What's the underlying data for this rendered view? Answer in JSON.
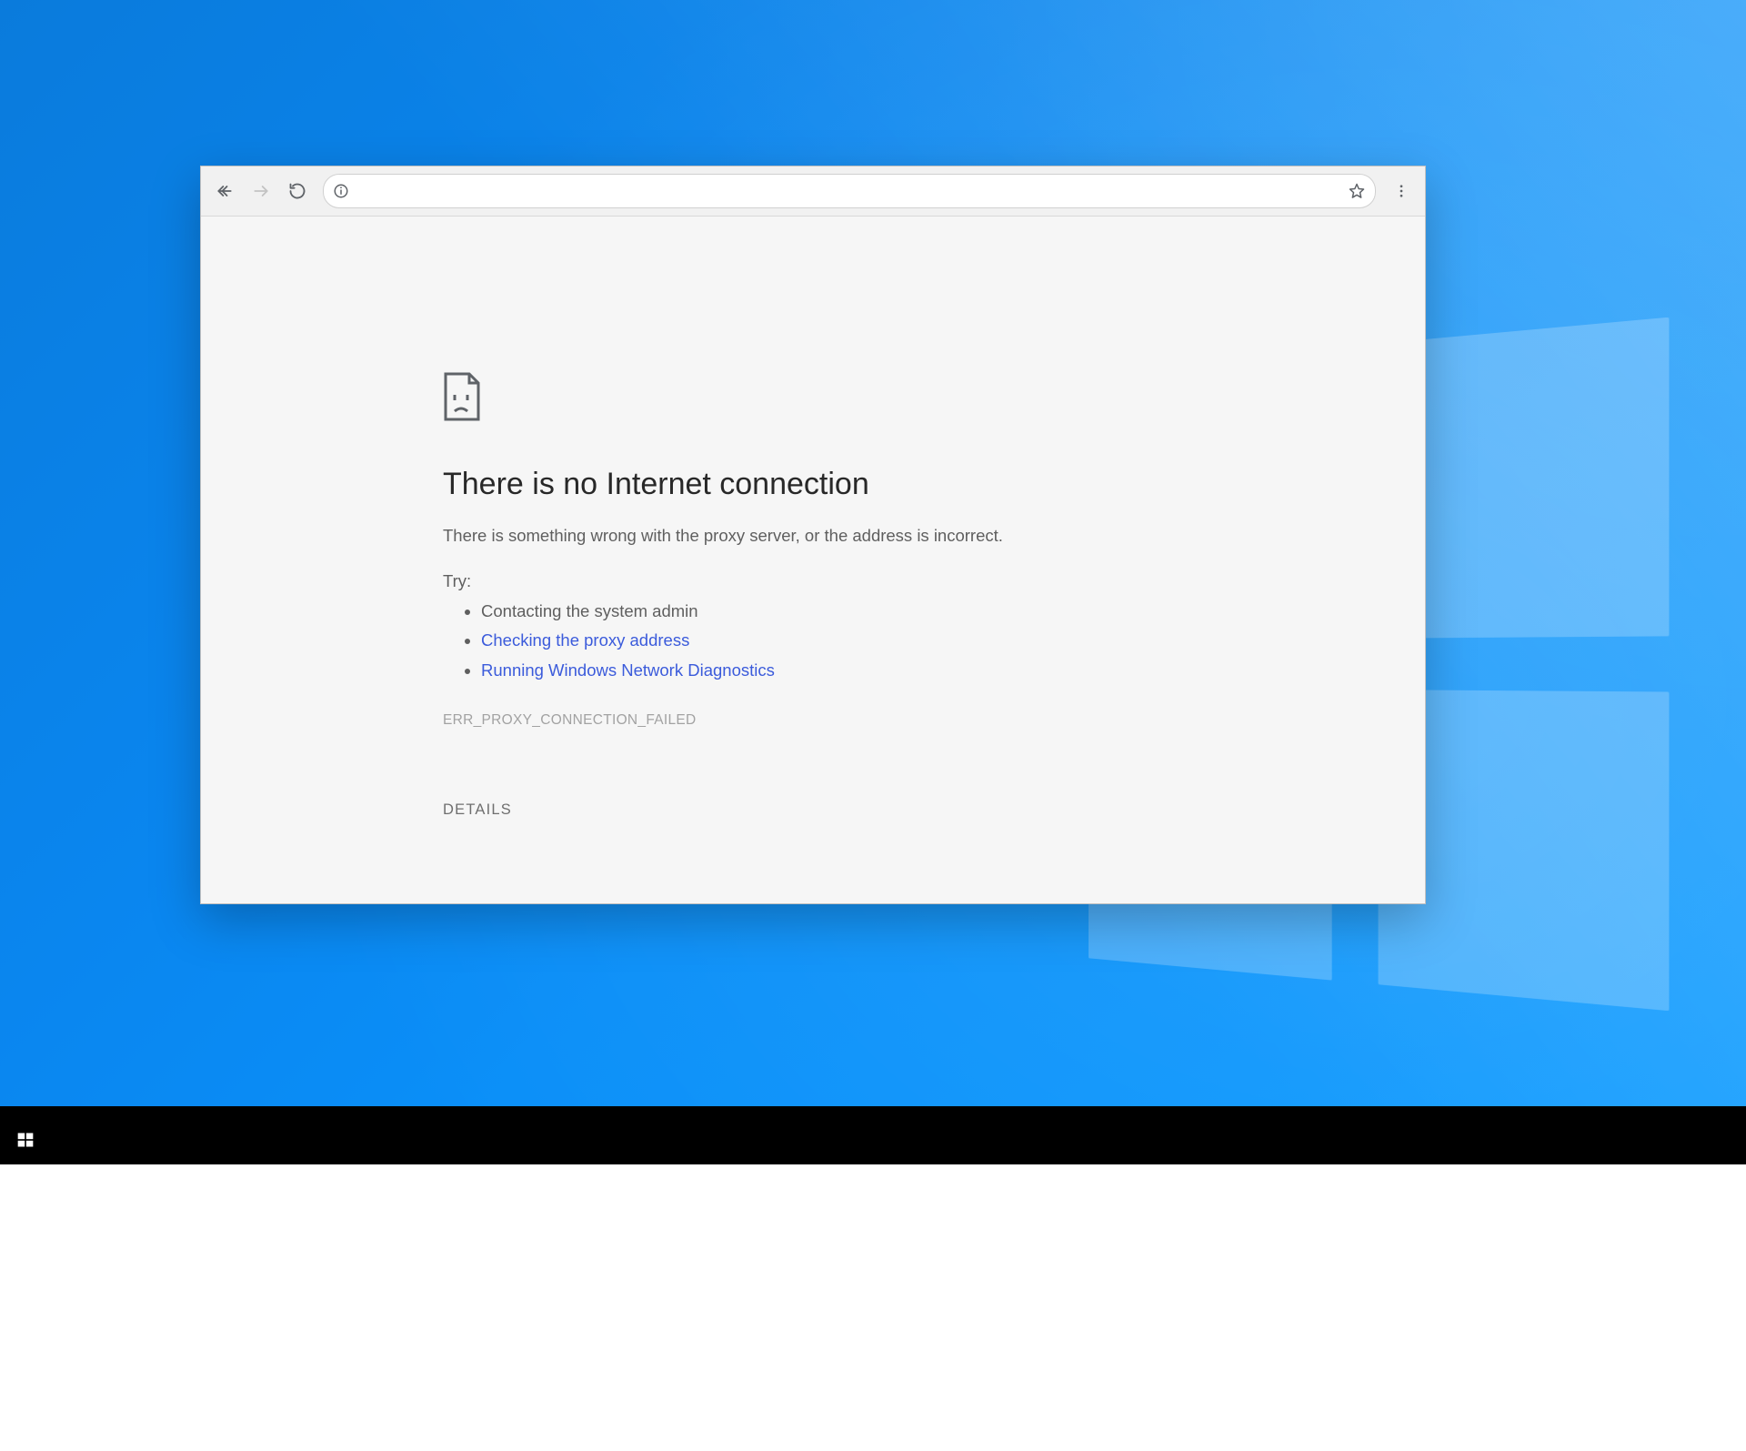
{
  "browser": {
    "toolbar": {
      "address_value": "",
      "address_placeholder": ""
    }
  },
  "error_page": {
    "title": "There is no Internet connection",
    "subtitle": "There is something wrong with the proxy server, or the address is incorrect.",
    "try_label": "Try:",
    "suggestions": {
      "contact_admin": "Contacting the system admin",
      "check_proxy": "Checking the proxy address",
      "run_diagnostics": "Running Windows Network Diagnostics"
    },
    "error_code": "ERR_PROXY_CONNECTION_FAILED",
    "details_button": "DETAILS"
  }
}
